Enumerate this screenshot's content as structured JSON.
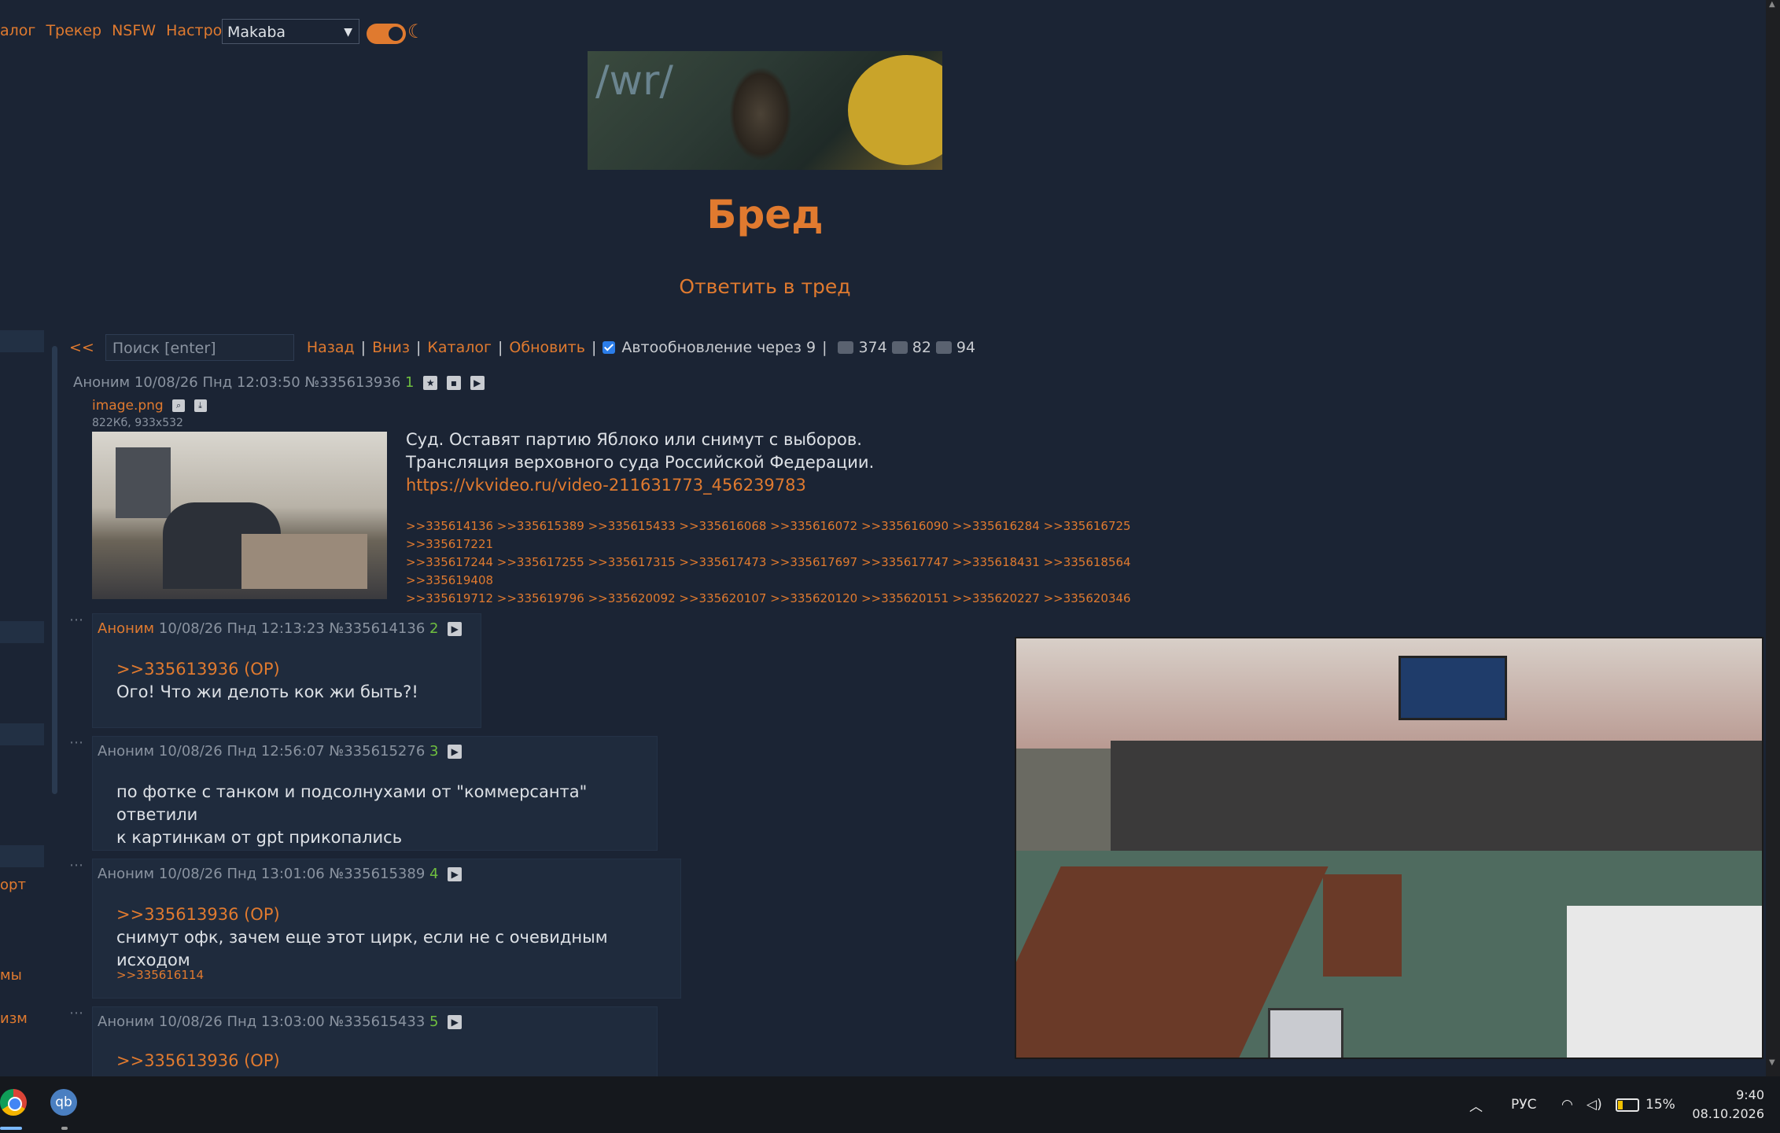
{
  "topnav": {
    "items": [
      "алог",
      "Трекер",
      "NSFW",
      "Настройки"
    ]
  },
  "style_select": {
    "value": "Makaba"
  },
  "banner": {
    "board_tag": "/wr/"
  },
  "board": {
    "title": "Бред",
    "reply_link": "Ответить в тред"
  },
  "sidebar": {
    "partial_labels": [
      "орт",
      "мы",
      "изм"
    ]
  },
  "toolbar": {
    "back_arrows": "<<",
    "search_placeholder": "Поиск [enter]",
    "back": "Назад",
    "down": "Вниз",
    "catalog": "Каталог",
    "refresh": "Обновить",
    "autoupdate": "Автообновление через 9",
    "posts_count": "374",
    "images_count": "82",
    "users_count": "94",
    "separator": "|"
  },
  "op": {
    "author": "Аноним",
    "datetime": "10/08/26 Пнд 12:03:50",
    "number": "№335613936",
    "index": "1",
    "file": {
      "name": "image.png",
      "info": "822Кб, 933x532"
    },
    "lines": [
      "Суд. Оставят партию Яблоко или снимут с выборов.",
      "Трансляция верховного суда Российской Федерации."
    ],
    "link": "https://vkvideo.ru/video-211631773_456239783",
    "reply_lines": [
      ">>335614136 >>335615389 >>335615433 >>335616068 >>335616072 >>335616090 >>335616284 >>335616725 >>335617221",
      ">>335617244 >>335617255 >>335617315 >>335617473 >>335617697 >>335617747 >>335618431 >>335618564 >>335619408",
      ">>335619712 >>335619796 >>335620092 >>335620107 >>335620120 >>335620151 >>335620227 >>335620346"
    ]
  },
  "posts": [
    {
      "author": "Аноним",
      "datetime": "10/08/26 Пнд 12:13:23",
      "number": "№335614136",
      "index": "2",
      "quote": ">>335613936 (OP)",
      "text": "Ого! Что жи делоть кок жи быть?!"
    },
    {
      "author": "Аноним",
      "datetime": "10/08/26 Пнд 12:56:07",
      "number": "№335615276",
      "index": "3",
      "text1": "по фотке с танком и подсолнухами от \"коммерсанта\" ответили",
      "text2": "к картинкам от gpt прикопались"
    },
    {
      "author": "Аноним",
      "datetime": "10/08/26 Пнд 13:01:06",
      "number": "№335615389",
      "index": "4",
      "quote": ">>335613936 (OP)",
      "text": "снимут офк, зачем еще этот цирк, если не с очевидным исходом",
      "reply": ">>335616114"
    },
    {
      "author": "Аноним",
      "datetime": "10/08/26 Пнд 13:03:00",
      "number": "№335615433",
      "index": "5",
      "quote": ">>335613936 (OP)"
    }
  ],
  "taskbar": {
    "apps": [
      "chrome-icon",
      "qbittorrent-icon"
    ],
    "qb_label": "qb",
    "lang": "РУС",
    "battery": "15%",
    "time": "9:40",
    "date": "08.10.2026"
  },
  "colors": {
    "accent": "#e07a2f",
    "background": "#1b2434",
    "post_bg": "#1f2b3d",
    "index_green": "#6fbf3f"
  }
}
